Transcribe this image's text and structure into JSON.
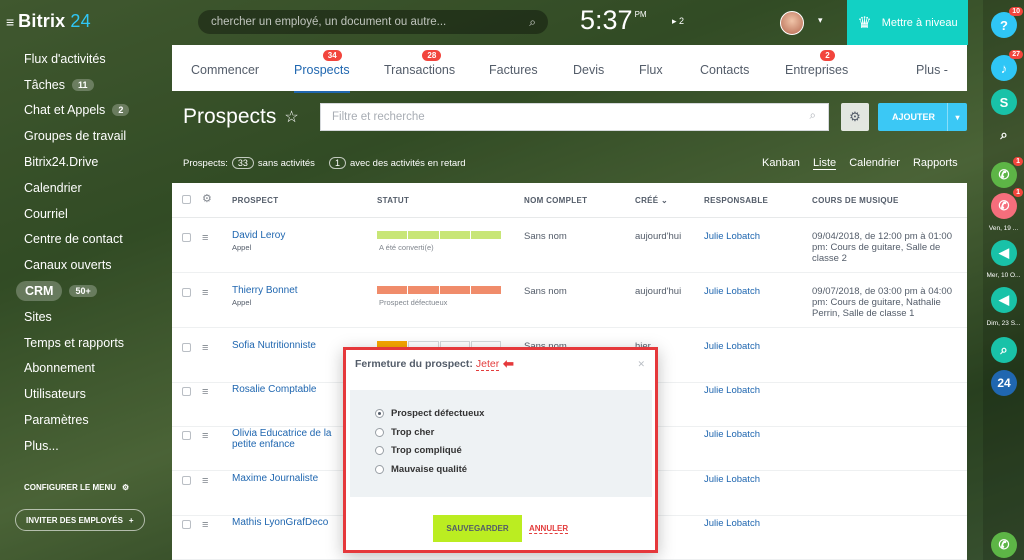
{
  "app": {
    "logo": "Bitrix",
    "logo_num": "24"
  },
  "sidebar": {
    "items": [
      {
        "label": "Flux d'activités",
        "badge": ""
      },
      {
        "label": "Tâches",
        "badge": "11"
      },
      {
        "label": "Chat et Appels",
        "badge": "2"
      },
      {
        "label": "Groupes de travail",
        "badge": ""
      },
      {
        "label": "Bitrix24.Drive",
        "badge": ""
      },
      {
        "label": "Calendrier",
        "badge": ""
      },
      {
        "label": "Courriel",
        "badge": ""
      },
      {
        "label": "Centre de contact",
        "badge": ""
      },
      {
        "label": "Canaux ouverts",
        "badge": ""
      },
      {
        "label": "CRM",
        "badge": "50+"
      },
      {
        "label": "Sites",
        "badge": ""
      },
      {
        "label": "Temps et rapports",
        "badge": ""
      },
      {
        "label": "Abonnement",
        "badge": ""
      },
      {
        "label": "Utilisateurs",
        "badge": ""
      },
      {
        "label": "Paramètres",
        "badge": ""
      },
      {
        "label": "Plus...",
        "badge": ""
      }
    ],
    "config_menu": "CONFIGURER LE MENU",
    "invite": "INVITER DES EMPLOYÉS"
  },
  "header": {
    "search_placeholder": "chercher un employé, un document ou autre...",
    "clock": "5:37",
    "clock_ampm": "PM",
    "clock_extra": "2",
    "upgrade": "Mettre à niveau"
  },
  "tabs": [
    {
      "label": "Commencer",
      "badge": ""
    },
    {
      "label": "Prospects",
      "badge": "34"
    },
    {
      "label": "Transactions",
      "badge": "28"
    },
    {
      "label": "Factures",
      "badge": ""
    },
    {
      "label": "Devis",
      "badge": ""
    },
    {
      "label": "Flux",
      "badge": ""
    },
    {
      "label": "Contacts",
      "badge": ""
    },
    {
      "label": "Entreprises",
      "badge": "2"
    },
    {
      "label": "Plus -",
      "badge": ""
    }
  ],
  "page": {
    "title": "Prospects",
    "filter_placeholder": "Filtre et recherche",
    "add": "AJOUTER",
    "counter_prefix": "Prospects:",
    "counter_count": "33",
    "counter_mid": "sans activités",
    "counter_late": "1",
    "counter_suffix": "avec des activités en retard",
    "views": [
      "Kanban",
      "Liste",
      "Calendrier",
      "Rapports"
    ]
  },
  "grid": {
    "columns": [
      "PROSPECT",
      "STATUT",
      "NOM COMPLET",
      "CRÉÉ",
      "RESPONSABLE",
      "COURS DE MUSIQUE"
    ],
    "rows": [
      {
        "name": "David Leroy",
        "sub": "Appel",
        "status": "A été converti(e)",
        "status_color": "#c8e677",
        "fill": 4,
        "fullname": "Sans nom",
        "created": "aujourd'hui",
        "responsible": "Julie Lobatch",
        "course": "09/04/2018, de 12:00 pm à 01:00 pm: Cours de guitare, Salle de classe 2"
      },
      {
        "name": "Thierry Bonnet",
        "sub": "Appel",
        "status": "Prospect défectueux",
        "status_color": "#f08c6b",
        "fill": 4,
        "fullname": "Sans nom",
        "created": "aujourd'hui",
        "responsible": "Julie Lobatch",
        "course": "09/07/2018, de 03:00 pm à 04:00 pm: Cours de guitare, Nathalie Perrin, Salle de classe 1"
      },
      {
        "name": "Sofia Nutritionniste",
        "sub": "",
        "status": "",
        "status_color": "#f7a700",
        "fill": 1,
        "fullname": "Sans nom",
        "created": "hier",
        "responsible": "Julie Lobatch",
        "course": ""
      },
      {
        "name": "Rosalie Comptable",
        "sub": "",
        "status": "",
        "status_color": "",
        "fill": 0,
        "fullname": "",
        "created": "",
        "responsible": "Julie Lobatch",
        "course": ""
      },
      {
        "name": "Olivia Educatrice de la petite enfance",
        "sub": "",
        "status": "",
        "status_color": "",
        "fill": 0,
        "fullname": "",
        "created": "",
        "responsible": "Julie Lobatch",
        "course": ""
      },
      {
        "name": "Maxime Journaliste",
        "sub": "",
        "status": "",
        "status_color": "",
        "fill": 0,
        "fullname": "",
        "created": "",
        "responsible": "Julie Lobatch",
        "course": ""
      },
      {
        "name": "Mathis LyonGrafDeco",
        "sub": "",
        "status": "",
        "status_color": "",
        "fill": 0,
        "fullname": "",
        "created": "",
        "responsible": "Julie Lobatch",
        "course": ""
      }
    ]
  },
  "modal": {
    "title": "Fermeture du prospect:",
    "link": "Jeter",
    "options": [
      "Prospect défectueux",
      "Trop cher",
      "Trop compliqué",
      "Mauvaise qualité"
    ],
    "selected": 0,
    "save": "SAUVEGARDER",
    "cancel": "ANNULER"
  },
  "rail": {
    "help_badge": "10",
    "bell_badge": "27",
    "call1_badge": "1",
    "call2_badge": "1",
    "date1": "Ven, 19 ...",
    "date2": "Mer, 10 O...",
    "date3": "Dim, 23 S...",
    "b24": "24"
  }
}
